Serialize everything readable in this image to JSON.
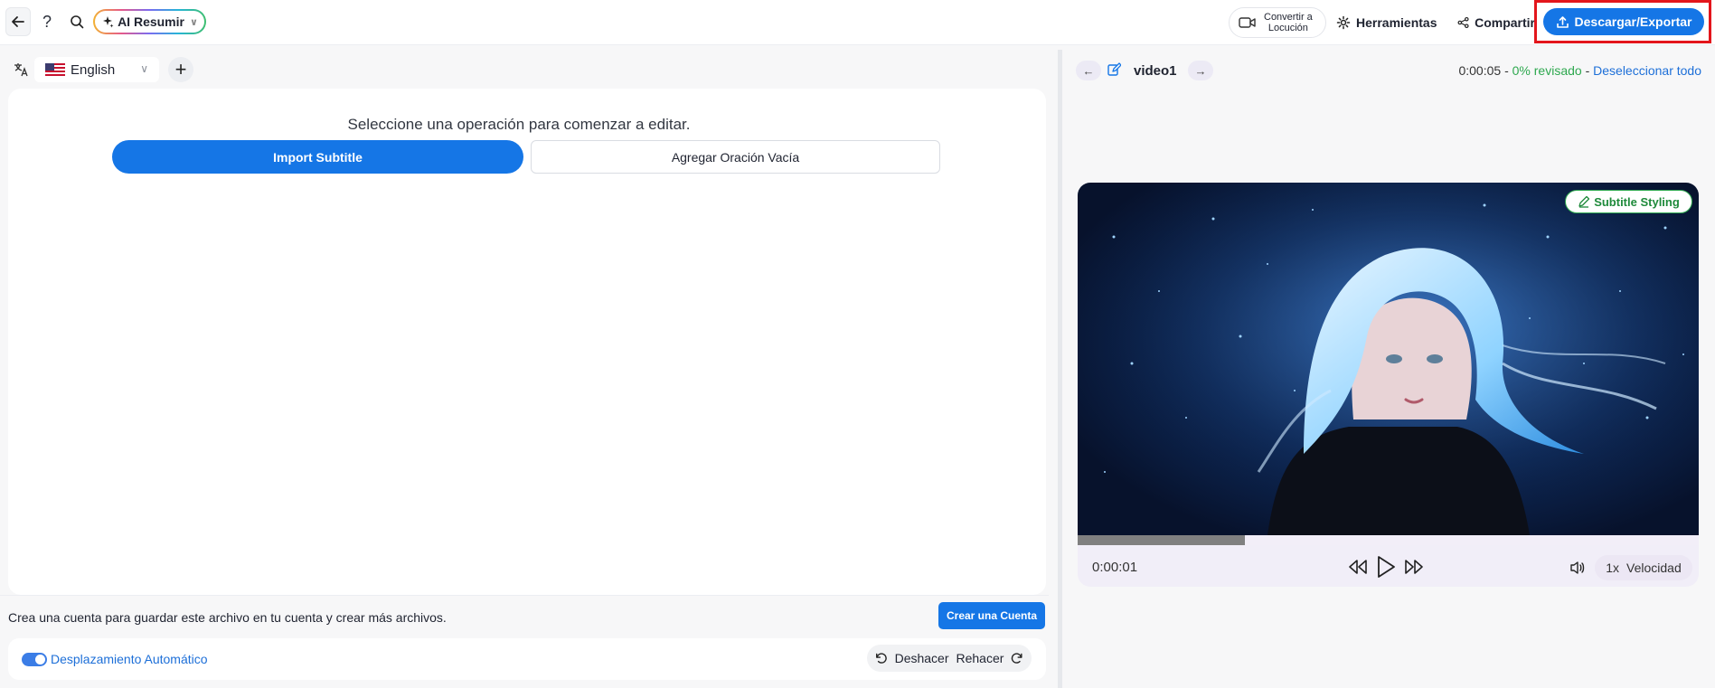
{
  "topbar": {
    "help_label": "?",
    "ai_label": "AI Resumir",
    "convert_label_line1": "Convertir a",
    "convert_label_line2": "Locución",
    "tools_label": "Herramientas",
    "share_label": "Compartir",
    "export_label": "Descargar/Exportar",
    "accent_color": "#1576e6",
    "highlight_color": "#e3161c"
  },
  "language": {
    "selected": "English"
  },
  "editor": {
    "prompt": "Seleccione una operación para comenzar a editar.",
    "import_label": "Import Subtitle",
    "empty_label": "Agregar Oración Vacía"
  },
  "account": {
    "message": "Crea una cuenta para guardar este archivo en tu cuenta y crear más archivos.",
    "create_label": "Crear una Cuenta"
  },
  "bottom": {
    "autoscroll_label": "Desplazamiento Automático",
    "autoscroll_on": true,
    "undo_label": "Deshacer",
    "redo_label": "Rehacer"
  },
  "video": {
    "title": "video1",
    "duration": "0:00:05",
    "sep1": "-",
    "reviewed": "0% revisado",
    "sep2": "-",
    "deselect_label": "Deseleccionar todo",
    "styling_label": "Subtitle Styling",
    "current_time": "0:00:01",
    "progress_fraction": 0.27,
    "speed_value": "1x",
    "speed_label": "Velocidad"
  }
}
